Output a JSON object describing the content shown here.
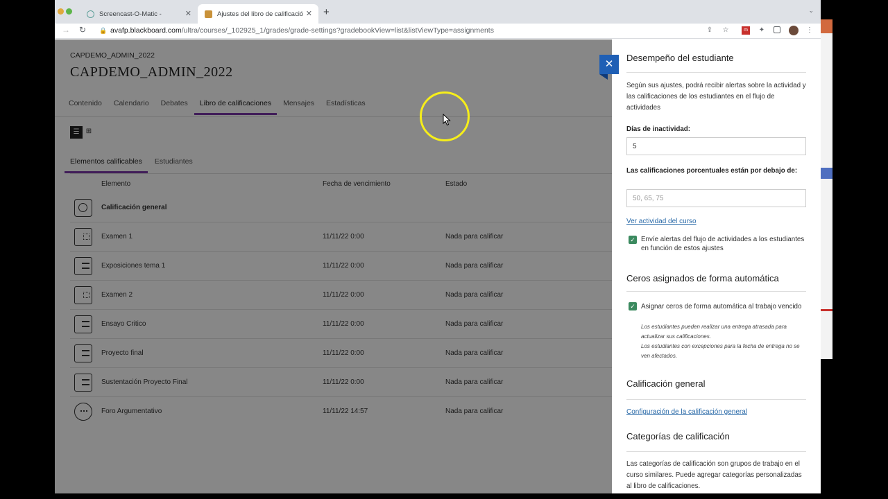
{
  "browser": {
    "tabs": [
      {
        "title": "Screencast-O-Matic -",
        "active": false
      },
      {
        "title": "Ajustes del libro de calificación",
        "active": true
      }
    ],
    "url_host": "avafp.blackboard.com",
    "url_path": "/ultra/courses/_102925_1/grades/grade-settings?gradebookView=list&listViewType=assignments"
  },
  "course": {
    "code": "CAPDEMO_ADMIN_2022",
    "title": "CAPDEMO_ADMIN_2022"
  },
  "nav": {
    "tabs": [
      "Contenido",
      "Calendario",
      "Debates",
      "Libro de calificaciones",
      "Mensajes",
      "Estadísticas"
    ],
    "active": "Libro de calificaciones"
  },
  "view_toggle": {
    "list_icon": "list-icon",
    "grid_icon": "grid-icon"
  },
  "subtabs": {
    "items": [
      "Elementos calificables",
      "Estudiantes"
    ],
    "active": "Elementos calificables"
  },
  "table": {
    "headers": {
      "element": "Elemento",
      "due": "Fecha de vencimiento",
      "state": "Estado"
    },
    "rows": [
      {
        "name": "Calificación general",
        "date": "",
        "state": "",
        "icon": "overall-grade-icon"
      },
      {
        "name": "Examen 1",
        "date": "11/11/22 0:00",
        "state": "Nada para calificar",
        "icon": "test-icon"
      },
      {
        "name": "Exposiciones tema 1",
        "date": "11/11/22 0:00",
        "state": "Nada para calificar",
        "icon": "assignment-icon"
      },
      {
        "name": "Examen 2",
        "date": "11/11/22 0:00",
        "state": "Nada para calificar",
        "icon": "test-icon"
      },
      {
        "name": "Ensayo Critico",
        "date": "11/11/22 0:00",
        "state": "Nada para calificar",
        "icon": "assignment-icon"
      },
      {
        "name": "Proyecto final",
        "date": "11/11/22 0:00",
        "state": "Nada para calificar",
        "icon": "assignment-icon"
      },
      {
        "name": "Sustentación Proyecto Final",
        "date": "11/11/22 0:00",
        "state": "Nada para calificar",
        "icon": "assignment-icon"
      },
      {
        "name": "Foro Argumentativo",
        "date": "11/11/22 14:57",
        "state": "Nada para calificar",
        "icon": "discussion-icon"
      }
    ]
  },
  "panel": {
    "section1_title": "Desempeño del estudiante",
    "section1_desc": "Según sus ajustes, podrá recibir alertas sobre la actividad y las calificaciones de los estudiantes en el flujo de actividades",
    "inactivity_label": "Días de inactividad:",
    "inactivity_value": "5",
    "percent_label": "Las calificaciones porcentuales están por debajo de:",
    "percent_placeholder": "50, 65, 75",
    "activity_link": "Ver actividad del curso",
    "alerts_check": "Envíe alertas del flujo de actividades a los estudiantes en función de estos ajustes",
    "section2_title": "Ceros asignados de forma automática",
    "zeros_check": "Asignar ceros de forma automática al trabajo vencido",
    "zeros_note1": "Los estudiantes pueden realizar una entrega atrasada para actualizar sus calificaciones.",
    "zeros_note2": "Los estudiantes con excepciones para la fecha de entrega no se ven afectados.",
    "section3_title": "Calificación general",
    "overall_link": "Configuración de la calificación general",
    "section4_title": "Categorías de calificación",
    "section4_desc": "Las categorías de calificación son grupos de trabajo en el curso similares. Puede agregar categorías personalizadas al libro de calificaciones."
  },
  "colors": {
    "accent": "#7b3aa8",
    "close_button": "#1f5fb5",
    "check": "#3b8a5f",
    "link": "#2a6aa8",
    "cursor_ring": "#f6ee1a"
  }
}
